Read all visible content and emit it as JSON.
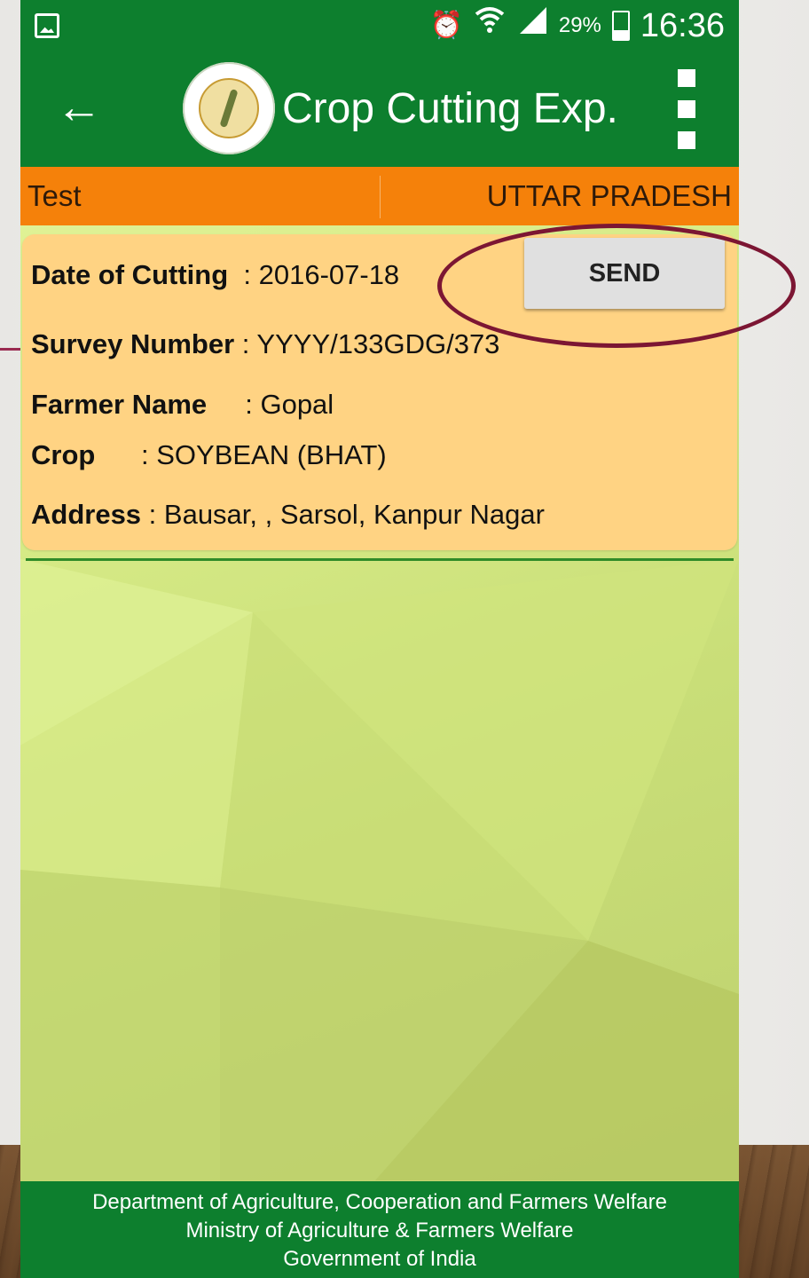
{
  "status_bar": {
    "battery": "29%",
    "time": "16:36"
  },
  "toolbar": {
    "title": "Crop Cutting Exp."
  },
  "info_bar": {
    "left": "Test",
    "right": "UTTAR PRADESH"
  },
  "record": {
    "date_label": "Date of Cutting",
    "date_value": ": 2016-07-18",
    "survey_label": "Survey Number",
    "survey_value": ": YYYY/133GDG/373",
    "farmer_label": "Farmer Name",
    "farmer_value": ": Gopal",
    "crop_label": "Crop",
    "crop_value": ": SOYBEAN (BHAT)",
    "address_label": "Address",
    "address_value": ": Bausar, , Sarsol, Kanpur Nagar",
    "send_label": "SEND"
  },
  "footer": {
    "line1": "Department of Agriculture, Cooperation and Farmers Welfare",
    "line2": "Ministry of Agriculture & Farmers Welfare",
    "line3": "Government of India"
  },
  "colors": {
    "primary": "#0d7f2e",
    "accent": "#f5810a",
    "card": "#ffd383",
    "highlight": "#7c1633"
  },
  "icons": [
    "gallery-icon",
    "alarm-icon",
    "wifi-icon",
    "signal-icon",
    "battery-icon",
    "back-arrow-icon",
    "app-logo",
    "overflow-menu-icon"
  ]
}
